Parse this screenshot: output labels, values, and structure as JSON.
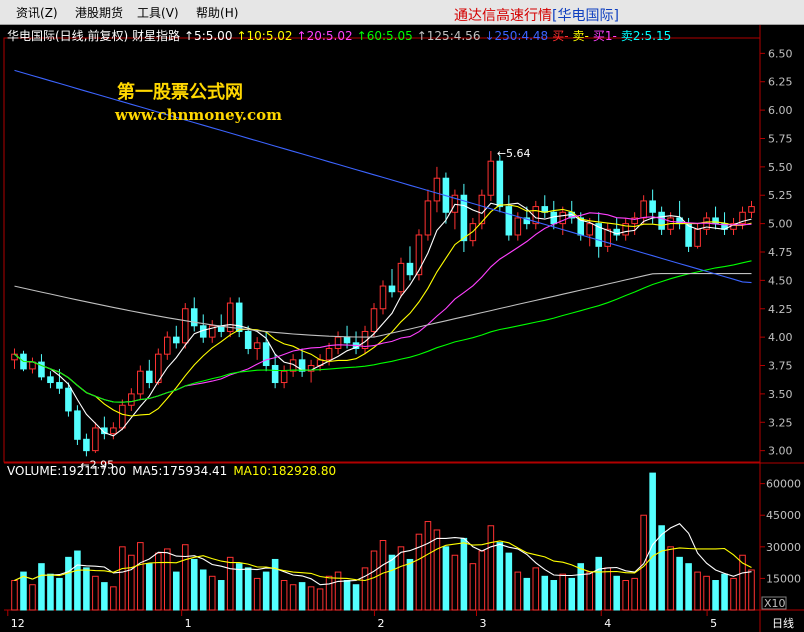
{
  "menu": {
    "items": [
      "资讯",
      "港股期货",
      "工具",
      "帮助"
    ],
    "mnemonics": [
      "(Z)",
      "",
      "(V)",
      "(H)"
    ]
  },
  "title": {
    "main": "通达信高速行情",
    "sub": "[华电国际]"
  },
  "chart": {
    "info": [
      {
        "text": "华电国际(日线,前复权) 财星指路",
        "color": "#ffffff"
      },
      {
        "text": "↑5:5.00",
        "color": "#ffffff"
      },
      {
        "text": "↑10:5.02",
        "color": "#ffff00"
      },
      {
        "text": "↑20:5.02",
        "color": "#ff40ff"
      },
      {
        "text": "↑60:5.05",
        "color": "#00ff00"
      },
      {
        "text": "↑125:4.56",
        "color": "#c0c0c0"
      },
      {
        "text": "↓250:4.48",
        "color": "#3c64ff"
      },
      {
        "text": "买-",
        "color": "#ff3030"
      },
      {
        "text": "卖-",
        "color": "#ffff00"
      },
      {
        "text": "买1-",
        "color": "#ff40ff"
      },
      {
        "text": "卖2:5.15",
        "color": "#00ffff"
      }
    ],
    "watermark_cn": "第一股票公式网",
    "watermark_url": "www.chnmoney.com",
    "price_axis": [
      "6.50",
      "6.25",
      "6.00",
      "5.75",
      "5.50",
      "5.25",
      "5.00",
      "4.75",
      "4.50",
      "4.25",
      "4.00",
      "3.75",
      "3.50",
      "3.25",
      "3.00"
    ],
    "price_ticks": [
      6.5,
      6.25,
      6.0,
      5.75,
      5.5,
      5.25,
      5.0,
      4.75,
      4.5,
      4.25,
      4.0,
      3.75,
      3.5,
      3.25,
      3.0
    ],
    "high_label": "5.64",
    "low_label": "2.95",
    "volume_info": [
      {
        "text": "VOLUME:192117.00",
        "color": "#ffffff"
      },
      {
        "text": "MA5:175934.41",
        "color": "#ffffff"
      },
      {
        "text": "MA10:182928.80",
        "color": "#ffff00"
      }
    ],
    "volume_axis": [
      "60000",
      "45000",
      "30000",
      "15000"
    ],
    "volume_ticks": [
      60000,
      45000,
      30000,
      15000
    ],
    "volume_unit": "X10",
    "date_labels": [
      "12",
      "1",
      "2",
      "3",
      "4",
      "5"
    ],
    "period": "日线"
  },
  "colors": {
    "up": "#ff3232",
    "down": "#54ffff",
    "axis": "#b00000",
    "ma5": "#ffffff",
    "ma10": "#ffff00",
    "ma20": "#ff40ff",
    "ma60": "#00ff00",
    "ma125": "#c0c0c0",
    "ma250": "#3c64ff"
  },
  "chart_data": {
    "type": "candlestick",
    "symbol": "华电国际",
    "period": "日线",
    "ylim": [
      2.9,
      6.6
    ],
    "volume_ylim": [
      0,
      66000
    ],
    "candles": [
      [
        3.8,
        3.9,
        3.72,
        3.85,
        14000
      ],
      [
        3.85,
        3.88,
        3.7,
        3.72,
        18000
      ],
      [
        3.72,
        3.82,
        3.68,
        3.78,
        12000
      ],
      [
        3.78,
        3.85,
        3.62,
        3.65,
        22000
      ],
      [
        3.65,
        3.7,
        3.55,
        3.6,
        17000
      ],
      [
        3.6,
        3.72,
        3.5,
        3.55,
        15000
      ],
      [
        3.55,
        3.6,
        3.3,
        3.35,
        25000
      ],
      [
        3.35,
        3.4,
        3.05,
        3.1,
        28000
      ],
      [
        3.1,
        3.15,
        2.95,
        3.0,
        20000
      ],
      [
        3.0,
        3.25,
        2.98,
        3.2,
        16000
      ],
      [
        3.2,
        3.3,
        3.1,
        3.15,
        13000
      ],
      [
        3.15,
        3.25,
        3.1,
        3.2,
        11000
      ],
      [
        3.2,
        3.45,
        3.18,
        3.4,
        30000
      ],
      [
        3.4,
        3.55,
        3.35,
        3.5,
        26000
      ],
      [
        3.5,
        3.75,
        3.45,
        3.7,
        32000
      ],
      [
        3.7,
        3.8,
        3.55,
        3.6,
        22000
      ],
      [
        3.6,
        3.9,
        3.58,
        3.85,
        27000
      ],
      [
        3.85,
        4.05,
        3.8,
        4.0,
        29000
      ],
      [
        4.0,
        4.1,
        3.9,
        3.95,
        18000
      ],
      [
        3.95,
        4.3,
        3.9,
        4.25,
        31000
      ],
      [
        4.25,
        4.35,
        4.05,
        4.1,
        24000
      ],
      [
        4.1,
        4.2,
        3.95,
        4.0,
        19000
      ],
      [
        4.0,
        4.15,
        3.95,
        4.1,
        16000
      ],
      [
        4.1,
        4.2,
        4.0,
        4.05,
        14000
      ],
      [
        4.05,
        4.35,
        4.0,
        4.3,
        25000
      ],
      [
        4.3,
        4.35,
        4.0,
        4.05,
        22000
      ],
      [
        4.05,
        4.1,
        3.85,
        3.9,
        20000
      ],
      [
        3.9,
        4.0,
        3.8,
        3.95,
        15000
      ],
      [
        3.95,
        4.05,
        3.7,
        3.75,
        18000
      ],
      [
        3.75,
        3.85,
        3.55,
        3.6,
        24000
      ],
      [
        3.6,
        3.75,
        3.55,
        3.7,
        14000
      ],
      [
        3.7,
        3.85,
        3.65,
        3.8,
        12000
      ],
      [
        3.8,
        3.9,
        3.65,
        3.7,
        13000
      ],
      [
        3.7,
        3.8,
        3.6,
        3.75,
        11000
      ],
      [
        3.75,
        3.85,
        3.7,
        3.8,
        10000
      ],
      [
        3.8,
        3.95,
        3.75,
        3.9,
        16000
      ],
      [
        3.9,
        4.05,
        3.85,
        4.0,
        18000
      ],
      [
        4.0,
        4.1,
        3.9,
        3.95,
        14000
      ],
      [
        3.95,
        4.05,
        3.85,
        3.9,
        12000
      ],
      [
        3.9,
        4.1,
        3.85,
        4.05,
        20000
      ],
      [
        4.05,
        4.3,
        4.0,
        4.25,
        28000
      ],
      [
        4.25,
        4.5,
        4.2,
        4.45,
        33000
      ],
      [
        4.45,
        4.6,
        4.35,
        4.4,
        26000
      ],
      [
        4.4,
        4.7,
        4.35,
        4.65,
        30000
      ],
      [
        4.65,
        4.8,
        4.5,
        4.55,
        24000
      ],
      [
        4.55,
        4.95,
        4.5,
        4.9,
        36000
      ],
      [
        4.9,
        5.3,
        4.85,
        5.2,
        42000
      ],
      [
        5.2,
        5.5,
        5.1,
        5.4,
        38000
      ],
      [
        5.4,
        5.45,
        5.0,
        5.1,
        30000
      ],
      [
        5.1,
        5.3,
        4.95,
        5.25,
        26000
      ],
      [
        5.25,
        5.35,
        4.75,
        4.85,
        34000
      ],
      [
        4.85,
        5.05,
        4.8,
        5.0,
        22000
      ],
      [
        5.0,
        5.3,
        4.95,
        5.25,
        28000
      ],
      [
        5.25,
        5.64,
        5.2,
        5.55,
        40000
      ],
      [
        5.55,
        5.6,
        5.1,
        5.15,
        32000
      ],
      [
        5.15,
        5.25,
        4.85,
        4.9,
        27000
      ],
      [
        4.9,
        5.1,
        4.85,
        5.05,
        18000
      ],
      [
        5.05,
        5.15,
        4.95,
        5.0,
        15000
      ],
      [
        5.0,
        5.2,
        4.95,
        5.15,
        20000
      ],
      [
        5.15,
        5.25,
        5.05,
        5.1,
        16000
      ],
      [
        5.1,
        5.2,
        4.95,
        5.0,
        14000
      ],
      [
        5.0,
        5.15,
        4.9,
        5.1,
        17000
      ],
      [
        5.1,
        5.2,
        5.0,
        5.05,
        15000
      ],
      [
        5.05,
        5.1,
        4.85,
        4.9,
        22000
      ],
      [
        4.9,
        5.05,
        4.8,
        5.0,
        18000
      ],
      [
        5.0,
        5.1,
        4.7,
        4.8,
        25000
      ],
      [
        4.8,
        5.0,
        4.75,
        4.95,
        20000
      ],
      [
        4.95,
        5.05,
        4.85,
        4.9,
        16000
      ],
      [
        4.9,
        5.05,
        4.85,
        5.0,
        14000
      ],
      [
        5.0,
        5.1,
        4.9,
        5.05,
        15000
      ],
      [
        5.05,
        5.25,
        5.0,
        5.2,
        45000
      ],
      [
        5.2,
        5.3,
        5.0,
        5.1,
        65000
      ],
      [
        5.1,
        5.15,
        4.9,
        4.95,
        40000
      ],
      [
        4.95,
        5.1,
        4.9,
        5.05,
        30000
      ],
      [
        5.05,
        5.2,
        4.95,
        5.0,
        25000
      ],
      [
        5.0,
        5.05,
        4.75,
        4.8,
        22000
      ],
      [
        4.8,
        5.0,
        4.78,
        4.95,
        18000
      ],
      [
        4.95,
        5.1,
        4.9,
        5.05,
        16000
      ],
      [
        5.05,
        5.15,
        4.95,
        5.0,
        14000
      ],
      [
        5.0,
        5.1,
        4.9,
        4.95,
        17000
      ],
      [
        4.95,
        5.05,
        4.9,
        5.0,
        15000
      ],
      [
        5.0,
        5.15,
        4.95,
        5.1,
        26000
      ],
      [
        5.1,
        5.2,
        5.05,
        5.15,
        19000
      ]
    ]
  }
}
